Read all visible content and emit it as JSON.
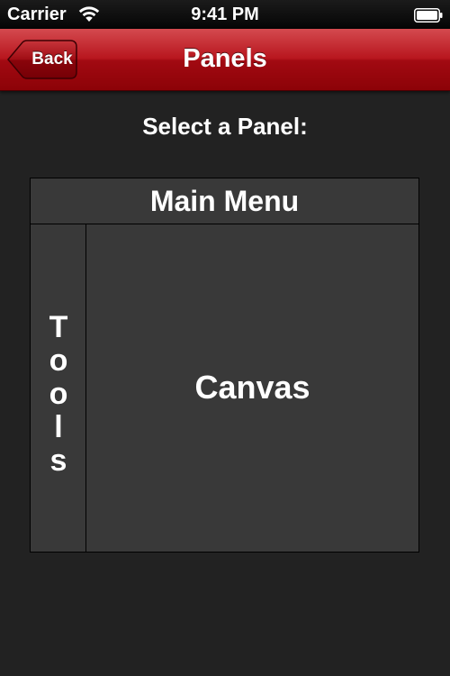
{
  "status_bar": {
    "carrier": "Carrier",
    "time": "9:41 PM",
    "icons": [
      "wifi-icon",
      "battery-icon"
    ]
  },
  "nav_bar": {
    "back_label": "Back",
    "title": "Panels",
    "color": "#b8161e"
  },
  "content": {
    "prompt": "Select a Panel:",
    "panels": {
      "main_menu": "Main Menu",
      "tools": [
        "T",
        "o",
        "o",
        "l",
        "s"
      ],
      "canvas": "Canvas"
    },
    "panel_background": "#393939",
    "page_background": "#222222"
  }
}
